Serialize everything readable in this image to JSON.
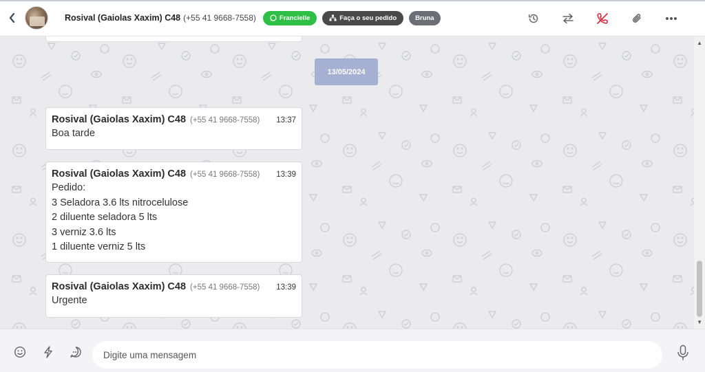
{
  "header": {
    "contact_name": "Rosival (Gaiolas Xaxim) C48",
    "contact_phone": "(+55 41 9668-7558)",
    "tags": [
      {
        "label": "Francielle",
        "icon": "whatsapp-icon",
        "color": "#2fbf46"
      },
      {
        "label": "Faça o seu pedido",
        "icon": "sitemap-icon",
        "color": "#4a4a4a"
      },
      {
        "label": "Bruna",
        "icon": "",
        "color": "#6b6f75"
      }
    ],
    "actions": [
      "history-icon",
      "transfer-icon",
      "end-call-icon",
      "attachment-icon",
      "more-icon"
    ]
  },
  "chat": {
    "date_separator": "13/05/2024",
    "messages": [
      {
        "sender": "Rosival (Gaiolas Xaxim) C48",
        "phone": "(+55 41 9668-7558)",
        "time": "13:37",
        "lines": [
          "Boa tarde"
        ]
      },
      {
        "sender": "Rosival (Gaiolas Xaxim) C48",
        "phone": "(+55 41 9668-7558)",
        "time": "13:39",
        "lines": [
          "Pedido:",
          "3 Seladora 3.6 lts nitrocelulose",
          "2 diluente seladora 5 lts",
          "3 verniz 3.6 lts",
          "1 diluente verniz 5 lts"
        ]
      },
      {
        "sender": "Rosival (Gaiolas Xaxim) C48",
        "phone": "(+55 41 9668-7558)",
        "time": "13:39",
        "lines": [
          "Urgente"
        ]
      }
    ]
  },
  "composer": {
    "placeholder": "Digite uma mensagem",
    "icons": [
      "emoji-icon",
      "lightning-icon",
      "quick-reply-icon",
      "microphone-icon"
    ]
  },
  "colors": {
    "accent_red": "#d9303e",
    "tag_green": "#2fbf46",
    "date_chip": "#a6b0d3",
    "chat_background": "#ebebed"
  }
}
